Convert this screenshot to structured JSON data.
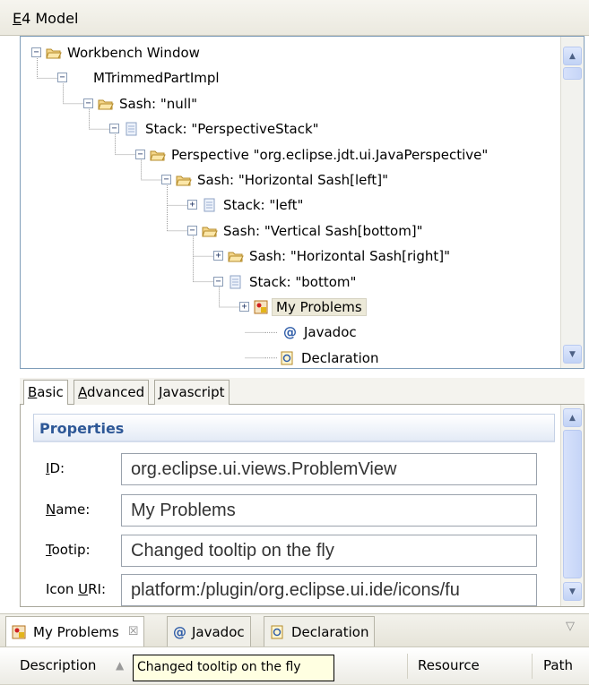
{
  "model_view": {
    "title": "E4 Model",
    "tree": [
      {
        "label": "Workbench Window",
        "icon": "folder-open-icon",
        "toggle": "minus"
      },
      {
        "label": "MTrimmedPartImpl",
        "icon": "none",
        "toggle": "minus"
      },
      {
        "label": "Sash: \"null\"",
        "icon": "folder-open-icon",
        "toggle": "minus"
      },
      {
        "label": "Stack: \"PerspectiveStack\"",
        "icon": "document-icon",
        "toggle": "minus"
      },
      {
        "label": "Perspective \"org.eclipse.jdt.ui.JavaPerspective\"",
        "icon": "folder-open-icon",
        "toggle": "minus"
      },
      {
        "label": "Sash: \"Horizontal Sash[left]\"",
        "icon": "folder-open-icon",
        "toggle": "minus"
      },
      {
        "label": "Stack: \"left\"",
        "icon": "document-icon",
        "toggle": "plus"
      },
      {
        "label": "Sash: \"Vertical Sash[bottom]\"",
        "icon": "folder-open-icon",
        "toggle": "minus"
      },
      {
        "label": "Sash: \"Horizontal Sash[right]\"",
        "icon": "folder-open-icon",
        "toggle": "plus"
      },
      {
        "label": "Stack: \"bottom\"",
        "icon": "document-icon",
        "toggle": "minus"
      },
      {
        "label": "My Problems",
        "icon": "problems-icon",
        "toggle": "plus",
        "selected": true
      },
      {
        "label": "Javadoc",
        "icon": "javadoc-icon",
        "toggle": "none"
      },
      {
        "label": "Declaration",
        "icon": "declaration-icon",
        "toggle": "none"
      }
    ]
  },
  "property_tabs": [
    "Basic",
    "Advanced",
    "Javascript"
  ],
  "properties": {
    "section_title": "Properties",
    "fields": [
      {
        "label": "ID:",
        "value": "org.eclipse.ui.views.ProblemView"
      },
      {
        "label": "Name:",
        "value": "My Problems"
      },
      {
        "label": "Tootip:",
        "value": "Changed tooltip on the fly"
      },
      {
        "label": "Icon URI:",
        "value": "platform:/plugin/org.eclipse.ui.ide/icons/fu"
      }
    ]
  },
  "bottom_tabs": [
    {
      "label": "My Problems",
      "icon": "problems-icon",
      "close": "☒"
    },
    {
      "label": "Javadoc",
      "icon": "javadoc-icon"
    },
    {
      "label": "Declaration",
      "icon": "declaration-icon"
    }
  ],
  "columns": [
    "Description",
    "Resource",
    "Path"
  ],
  "tooltip": "Changed tooltip on the fly",
  "colors": {
    "accent": "#2e5897",
    "selection": "#ece9d8",
    "tooltip_bg": "#ffffe1"
  }
}
